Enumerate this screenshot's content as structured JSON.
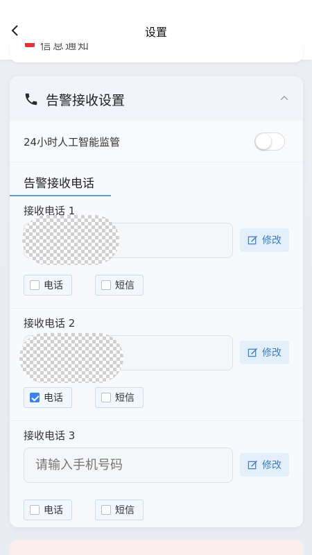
{
  "header": {
    "title": "设置"
  },
  "top_card": {
    "text": "信息通知"
  },
  "alarm": {
    "title": "告警接收设置",
    "ai_monitor_label": "24小时人工智能监管",
    "ai_monitor_enabled": false,
    "tab_label": "告警接收电话",
    "phones": [
      {
        "label": "接收电话 1",
        "value": "",
        "placeholder": "",
        "call": false,
        "sms": false,
        "redacted": true
      },
      {
        "label": "接收电话 2",
        "value": "",
        "placeholder": "",
        "call": true,
        "sms": false,
        "redacted": true
      },
      {
        "label": "接收电话 3",
        "value": "",
        "placeholder": "请输入手机号码",
        "call": false,
        "sms": false,
        "redacted": false
      }
    ],
    "edit_label": "修改",
    "call_label": "电话",
    "sms_label": "短信"
  },
  "colors": {
    "accent": "#3b7cc1",
    "accent_bg": "#e3effb",
    "checked": "#3b82f6"
  }
}
